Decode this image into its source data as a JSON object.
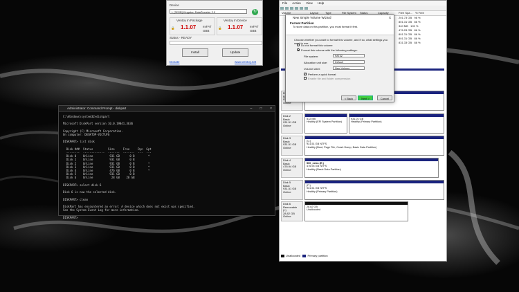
{
  "ventoy": {
    "device_label": "Device",
    "device_value": "I: [32GB] Kingston DataTraveler 2.0",
    "pkg_label": "Ventoy In Package",
    "dev_label": "Ventoy In Device",
    "pkg_version": "1.1.07",
    "dev_version": "1.1.07",
    "fs1": "exFAT",
    "fs1b": "GBB",
    "fs2": "exFAT",
    "fs2b": "GBB",
    "status": "Status - READY",
    "install": "Install",
    "update": "Update",
    "link_left": "Donate",
    "link_right": "www.ventoy.net"
  },
  "cmd": {
    "title": "Administrator: Command Prompt - diskpart",
    "lines": "C:\\Windows\\system32>diskpart\n\nMicrosoft DiskPart version 10.0.19041.3636\n\nCopyright (C) Microsoft Corporation.\nOn computer: DESKTOP-V1CTUF6\n\nDISKPART> list disk\n\n  Disk ###  Status         Size     Free     Dyn  Gpt\n  --------  -------------  -------  -------  ---  ---\n  Disk 0    Online          931 GB      0 B        *\n  Disk 1    Online          931 GB      0 B\n  Disk 2    Online          931 GB      0 B        *\n  Disk 3    Online          931 GB      0 B        *\n  Disk 4    Online          476 GB      0 B        *\n  Disk 5    Online          931 GB      0 B\n  Disk 6    Online           28 GB    28 GB\n\nDISKPART> select disk 6\n\nDisk 6 is now the selected disk.\n\nDISKPART> clean\n\nDiskPart has encountered an error: A device which does not exist was specified.\nSee the System Event Log for more information.\n\nDISKPART> "
  },
  "dm": {
    "menu": [
      "File",
      "Action",
      "View",
      "Help"
    ],
    "cols": [
      "Volume",
      "Layout",
      "Type",
      "File System",
      "Status",
      "Capacity",
      "Free Spa...",
      "% Free"
    ],
    "rows": [
      [
        "201.73 GB",
        "98 %"
      ],
      [
        "801.31 GB",
        "86 %"
      ],
      [
        "340 MB",
        "100 %"
      ],
      [
        "476.03 GB",
        "86 %"
      ],
      [
        "801.31 GB",
        "86 %"
      ],
      [
        "801.31 GB",
        "86 %"
      ],
      [
        "831.33 GB",
        "88 %"
      ]
    ],
    "disks": [
      {
        "info": [
          "Disk 1",
          "Basic",
          "931.51 GB",
          "Online"
        ],
        "parts": [
          [
            "",
            "Healthy (Primary Partition)"
          ]
        ]
      },
      {
        "info": [
          "Disk 2",
          "Basic",
          "931.51 GB",
          "Online"
        ],
        "parts": [
          [
            "512 MB",
            "Healthy (EFI System Partition)"
          ],
          [
            "931.01 GB",
            "Healthy (Primary Partition)"
          ]
        ]
      },
      {
        "info": [
          "Disk 3",
          "Basic",
          "931.51 GB",
          "Online"
        ],
        "parts": [
          [
            "(C:)",
            "931.51 GB NTFS",
            "Healthy (Boot, Page File, Crash Dump, Basic Data Partition)"
          ]
        ]
      },
      {
        "info": [
          "Disk 4",
          "Basic",
          "476.94 GB",
          "Online"
        ],
        "parts": [
          [
            "500_extra (E:)",
            "476.94 GB NTFS",
            "Healthy (Basic Data Partition)"
          ]
        ]
      },
      {
        "info": [
          "Disk 5",
          "Basic",
          "931.51 GB",
          "Online"
        ],
        "parts": [
          [
            "(F:)",
            "931.51 GB NTFS",
            "Healthy (Primary Partition)"
          ]
        ]
      },
      {
        "info": [
          "Disk 6",
          "Removable (I:)",
          "28.82 GB",
          "Online"
        ],
        "parts": [
          [
            "28.82 GB",
            "Unallocated"
          ]
        ]
      }
    ],
    "legend": [
      "Unallocated",
      "Primary partition"
    ]
  },
  "wizard": {
    "title": "New Simple Volume Wizard",
    "close": "X",
    "heading": "Format Partition",
    "subheading": "To store data on this partition, you must format it first.",
    "prompt": "Choose whether you want to format this volume, and if so, what settings you want to use.",
    "opt_no": "Do not format this volume",
    "opt_yes": "Format this volume with the following settings:",
    "fs_label": "File system:",
    "fs_value": "FAT32",
    "alloc_label": "Allocation unit size:",
    "alloc_value": "Default",
    "vol_label": "Volume label:",
    "vol_value": "New Volume",
    "quick": "Perform a quick format",
    "compress": "Enable file and folder compression",
    "back": "< Back",
    "next": "Next >",
    "cancel": "Cancel"
  }
}
